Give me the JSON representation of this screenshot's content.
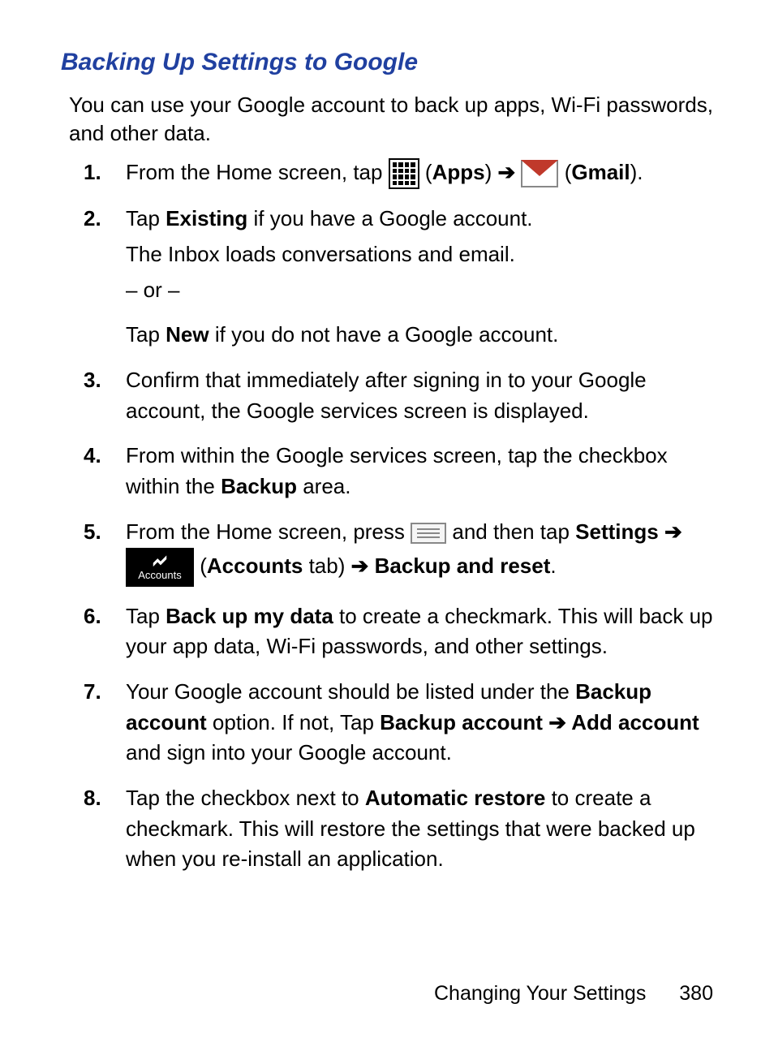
{
  "heading": "Backing Up Settings to Google",
  "intro": "You can use your Google account to back up apps, Wi-Fi passwords, and other data.",
  "steps": {
    "s1": {
      "num": "1.",
      "t1": "From the Home screen, tap ",
      "apps_label": "Apps",
      "gmail_label": "Gmail"
    },
    "s2": {
      "num": "2.",
      "t1": "Tap ",
      "existing": "Existing",
      "t2": " if you have a Google account.",
      "inbox": "The Inbox loads conversations and email.",
      "or": "– or –",
      "t3a": "Tap ",
      "new": "New",
      "t3b": " if you do not have a Google account."
    },
    "s3": {
      "num": "3.",
      "text": "Confirm that immediately after signing in to your Google account, the Google services screen is displayed."
    },
    "s4": {
      "num": "4.",
      "t1": "From within the Google services screen, tap the checkbox within the ",
      "backup": "Backup",
      "t2": " area."
    },
    "s5": {
      "num": "5.",
      "t1": "From the Home screen, press ",
      "t2": " and then tap ",
      "settings": "Settings",
      "accounts_icon_label": "Accounts",
      "accounts_tab": "Accounts",
      "tab_suffix": " tab)",
      "backup_reset": "Backup and reset"
    },
    "s6": {
      "num": "6.",
      "t1": "Tap ",
      "back_up_my_data": "Back up my data",
      "t2": " to create a checkmark. This will back up your app data, Wi-Fi passwords, and other settings."
    },
    "s7": {
      "num": "7.",
      "t1": "Your Google account should be listed under the ",
      "backup_account": "Backup account",
      "t2": " option. If not, Tap ",
      "backup_account2": "Backup account",
      "add_account": "Add account",
      "t3": " and sign into your Google account."
    },
    "s8": {
      "num": "8.",
      "t1": "Tap the checkbox next to ",
      "auto_restore": "Automatic restore",
      "t2": " to create a checkmark. This will restore the settings that were backed up when you re-install an application."
    }
  },
  "arrow": " ➔ ",
  "footer": {
    "section": "Changing Your Settings",
    "page": "380"
  }
}
